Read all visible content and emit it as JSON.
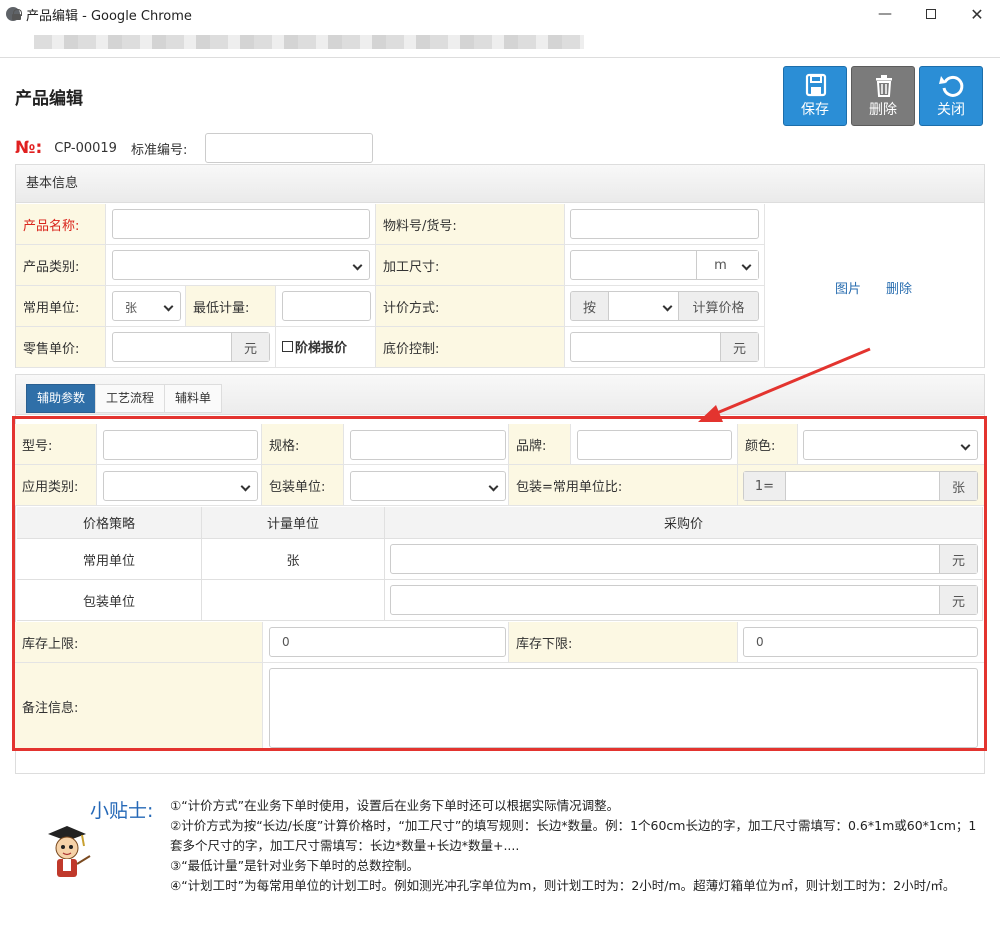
{
  "window": {
    "title": "产品编辑 - Google Chrome"
  },
  "page": {
    "title": "产品编辑"
  },
  "toolbar": {
    "save_label": "保存",
    "delete_label": "删除",
    "close_label": "关闭"
  },
  "header": {
    "no_symbol": "№:",
    "no_value": "CP-00019",
    "std_label": "标准编号:",
    "std_value": ""
  },
  "basic": {
    "title": "基本信息",
    "product_name_label": "产品名称:",
    "material_label": "物料号/货号:",
    "category_label": "产品类别:",
    "size_label": "加工尺寸:",
    "size_unit": "m",
    "unit_label": "常用单位:",
    "unit_value": "张",
    "min_label": "最低计量:",
    "pricing_label": "计价方式:",
    "pricing_prefix": "按",
    "calc_price": "计算价格",
    "retail_label": "零售单价:",
    "yuan": "元",
    "tier_label": "阶梯报价",
    "floor_label": "底价控制:",
    "image_link": "图片",
    "delete_link": "删除"
  },
  "tabs": [
    "辅助参数",
    "工艺流程",
    "辅料单"
  ],
  "aux": {
    "model_label": "型号:",
    "spec_label": "规格:",
    "brand_label": "品牌:",
    "color_label": "颜色:",
    "app_cat_label": "应用类别:",
    "pack_unit_label": "包装单位:",
    "ratio_label": "包装=常用单位比:",
    "ratio_prefix": "1=",
    "ratio_suffix": "张",
    "price_table": {
      "headers": [
        "价格策略",
        "计量单位",
        "采购价"
      ],
      "rows": [
        {
          "strategy": "常用单位",
          "unit": "张",
          "suffix": "元"
        },
        {
          "strategy": "包装单位",
          "unit": "",
          "suffix": "元"
        }
      ]
    },
    "stock_upper_label": "库存上限:",
    "stock_upper_value": "0",
    "stock_lower_label": "库存下限:",
    "stock_lower_value": "0",
    "remark_label": "备注信息:"
  },
  "tips": {
    "title": "小贴士:",
    "lines": [
      "①“计价方式”在业务下单时使用，设置后在业务下单时还可以根据实际情况调整。",
      "②计价方式为按“长边/长度”计算价格时，“加工尺寸”的填写规则：长边*数量。例：1个60cm长边的字，加工尺寸需填写：0.6*1m或60*1cm；1套多个尺寸的字，加工尺寸需填写：长边*数量+长边*数量+....",
      "③“最低计量”是针对业务下单时的总数控制。",
      "④“计划工时”为每常用单位的计划工时。例如测光冲孔字单位为m，则计划工时为：2小时/m。超薄灯箱单位为㎡，则计划工时为：2小时/㎡。"
    ]
  },
  "colors": {
    "primary": "#2b8ed6",
    "label_bg": "#fcf8e3",
    "required": "#d9251c",
    "highlight": "#e3342f",
    "tab_active": "#2f6fa8"
  }
}
